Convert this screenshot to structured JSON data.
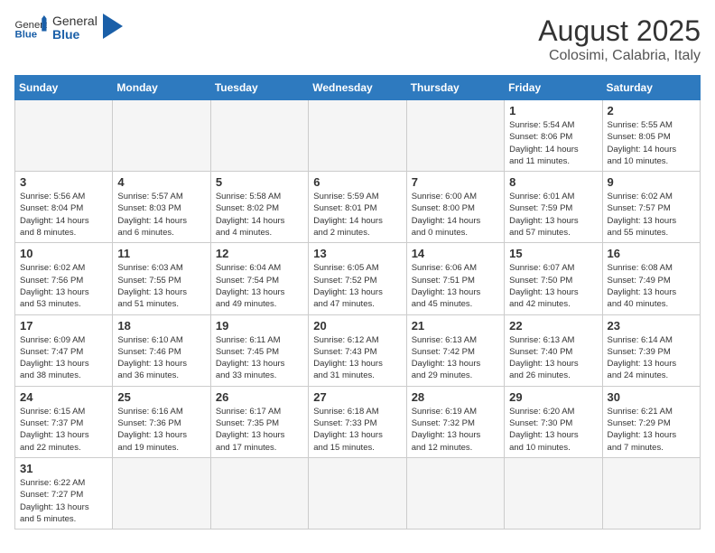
{
  "header": {
    "logo_general": "General",
    "logo_blue": "Blue",
    "month_year": "August 2025",
    "location": "Colosimi, Calabria, Italy"
  },
  "weekdays": [
    "Sunday",
    "Monday",
    "Tuesday",
    "Wednesday",
    "Thursday",
    "Friday",
    "Saturday"
  ],
  "weeks": [
    [
      {
        "day": "",
        "info": ""
      },
      {
        "day": "",
        "info": ""
      },
      {
        "day": "",
        "info": ""
      },
      {
        "day": "",
        "info": ""
      },
      {
        "day": "",
        "info": ""
      },
      {
        "day": "1",
        "info": "Sunrise: 5:54 AM\nSunset: 8:06 PM\nDaylight: 14 hours\nand 11 minutes."
      },
      {
        "day": "2",
        "info": "Sunrise: 5:55 AM\nSunset: 8:05 PM\nDaylight: 14 hours\nand 10 minutes."
      }
    ],
    [
      {
        "day": "3",
        "info": "Sunrise: 5:56 AM\nSunset: 8:04 PM\nDaylight: 14 hours\nand 8 minutes."
      },
      {
        "day": "4",
        "info": "Sunrise: 5:57 AM\nSunset: 8:03 PM\nDaylight: 14 hours\nand 6 minutes."
      },
      {
        "day": "5",
        "info": "Sunrise: 5:58 AM\nSunset: 8:02 PM\nDaylight: 14 hours\nand 4 minutes."
      },
      {
        "day": "6",
        "info": "Sunrise: 5:59 AM\nSunset: 8:01 PM\nDaylight: 14 hours\nand 2 minutes."
      },
      {
        "day": "7",
        "info": "Sunrise: 6:00 AM\nSunset: 8:00 PM\nDaylight: 14 hours\nand 0 minutes."
      },
      {
        "day": "8",
        "info": "Sunrise: 6:01 AM\nSunset: 7:59 PM\nDaylight: 13 hours\nand 57 minutes."
      },
      {
        "day": "9",
        "info": "Sunrise: 6:02 AM\nSunset: 7:57 PM\nDaylight: 13 hours\nand 55 minutes."
      }
    ],
    [
      {
        "day": "10",
        "info": "Sunrise: 6:02 AM\nSunset: 7:56 PM\nDaylight: 13 hours\nand 53 minutes."
      },
      {
        "day": "11",
        "info": "Sunrise: 6:03 AM\nSunset: 7:55 PM\nDaylight: 13 hours\nand 51 minutes."
      },
      {
        "day": "12",
        "info": "Sunrise: 6:04 AM\nSunset: 7:54 PM\nDaylight: 13 hours\nand 49 minutes."
      },
      {
        "day": "13",
        "info": "Sunrise: 6:05 AM\nSunset: 7:52 PM\nDaylight: 13 hours\nand 47 minutes."
      },
      {
        "day": "14",
        "info": "Sunrise: 6:06 AM\nSunset: 7:51 PM\nDaylight: 13 hours\nand 45 minutes."
      },
      {
        "day": "15",
        "info": "Sunrise: 6:07 AM\nSunset: 7:50 PM\nDaylight: 13 hours\nand 42 minutes."
      },
      {
        "day": "16",
        "info": "Sunrise: 6:08 AM\nSunset: 7:49 PM\nDaylight: 13 hours\nand 40 minutes."
      }
    ],
    [
      {
        "day": "17",
        "info": "Sunrise: 6:09 AM\nSunset: 7:47 PM\nDaylight: 13 hours\nand 38 minutes."
      },
      {
        "day": "18",
        "info": "Sunrise: 6:10 AM\nSunset: 7:46 PM\nDaylight: 13 hours\nand 36 minutes."
      },
      {
        "day": "19",
        "info": "Sunrise: 6:11 AM\nSunset: 7:45 PM\nDaylight: 13 hours\nand 33 minutes."
      },
      {
        "day": "20",
        "info": "Sunrise: 6:12 AM\nSunset: 7:43 PM\nDaylight: 13 hours\nand 31 minutes."
      },
      {
        "day": "21",
        "info": "Sunrise: 6:13 AM\nSunset: 7:42 PM\nDaylight: 13 hours\nand 29 minutes."
      },
      {
        "day": "22",
        "info": "Sunrise: 6:13 AM\nSunset: 7:40 PM\nDaylight: 13 hours\nand 26 minutes."
      },
      {
        "day": "23",
        "info": "Sunrise: 6:14 AM\nSunset: 7:39 PM\nDaylight: 13 hours\nand 24 minutes."
      }
    ],
    [
      {
        "day": "24",
        "info": "Sunrise: 6:15 AM\nSunset: 7:37 PM\nDaylight: 13 hours\nand 22 minutes."
      },
      {
        "day": "25",
        "info": "Sunrise: 6:16 AM\nSunset: 7:36 PM\nDaylight: 13 hours\nand 19 minutes."
      },
      {
        "day": "26",
        "info": "Sunrise: 6:17 AM\nSunset: 7:35 PM\nDaylight: 13 hours\nand 17 minutes."
      },
      {
        "day": "27",
        "info": "Sunrise: 6:18 AM\nSunset: 7:33 PM\nDaylight: 13 hours\nand 15 minutes."
      },
      {
        "day": "28",
        "info": "Sunrise: 6:19 AM\nSunset: 7:32 PM\nDaylight: 13 hours\nand 12 minutes."
      },
      {
        "day": "29",
        "info": "Sunrise: 6:20 AM\nSunset: 7:30 PM\nDaylight: 13 hours\nand 10 minutes."
      },
      {
        "day": "30",
        "info": "Sunrise: 6:21 AM\nSunset: 7:29 PM\nDaylight: 13 hours\nand 7 minutes."
      }
    ],
    [
      {
        "day": "31",
        "info": "Sunrise: 6:22 AM\nSunset: 7:27 PM\nDaylight: 13 hours\nand 5 minutes."
      },
      {
        "day": "",
        "info": ""
      },
      {
        "day": "",
        "info": ""
      },
      {
        "day": "",
        "info": ""
      },
      {
        "day": "",
        "info": ""
      },
      {
        "day": "",
        "info": ""
      },
      {
        "day": "",
        "info": ""
      }
    ]
  ]
}
